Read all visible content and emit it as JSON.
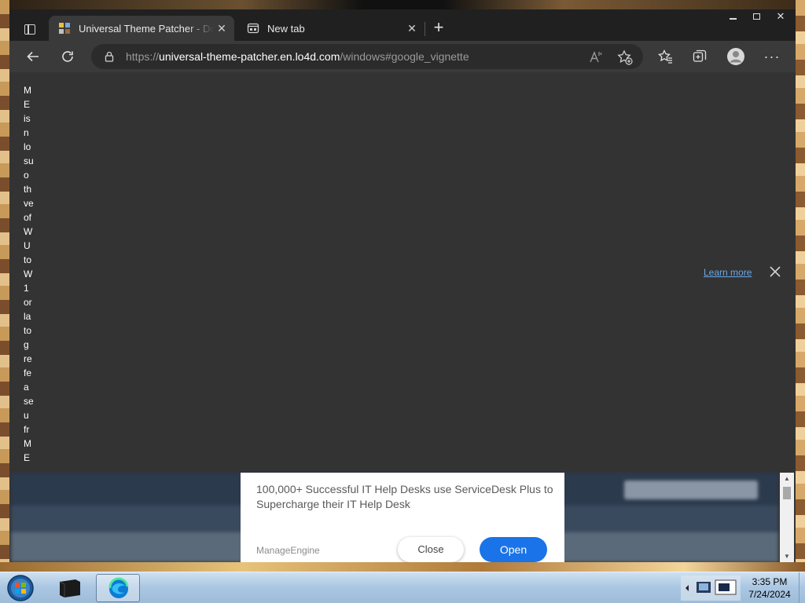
{
  "browser": {
    "tabs": [
      {
        "title": "Universal Theme Patcher - Down",
        "active": true
      },
      {
        "title": "New tab",
        "active": false
      }
    ],
    "address": {
      "scheme": "https://",
      "host": "universal-theme-patcher.en.lo4d.com",
      "path": "/windows#google_vignette"
    }
  },
  "page": {
    "side_text": [
      "M",
      "E",
      "is",
      "n",
      "lo",
      "su",
      "o",
      "th",
      "ve",
      "of",
      "W",
      "U",
      "to",
      "W",
      "1",
      "or",
      "la",
      "to",
      "g",
      "re",
      "fe",
      "a",
      "se",
      "u",
      "fr",
      "M",
      "E"
    ],
    "vignette": {
      "learn_more": "Learn more"
    },
    "ad": {
      "description": "100,000+ Successful IT Help Desks use ServiceDesk Plus to Supercharge their IT Help Desk",
      "advertiser": "ManageEngine",
      "close_label": "Close",
      "open_label": "Open",
      "open_color": "#1a73e8"
    }
  },
  "taskbar": {
    "time": "3:35 PM",
    "date": "7/24/2024"
  }
}
